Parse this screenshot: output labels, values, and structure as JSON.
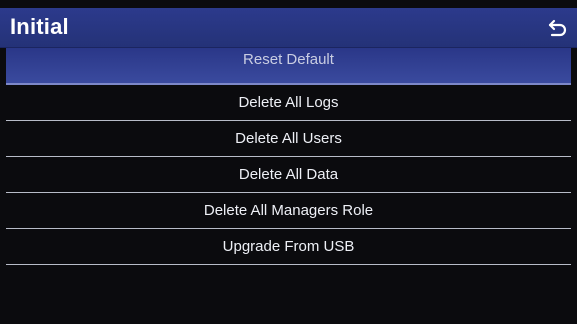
{
  "header": {
    "title": "Initial",
    "back_icon": "back-arrow-icon"
  },
  "menu": {
    "items": [
      {
        "label": "Reset Default",
        "selected": true
      },
      {
        "label": "Delete All Logs"
      },
      {
        "label": "Delete All Users"
      },
      {
        "label": "Delete All Data"
      },
      {
        "label": "Delete All Managers Role"
      },
      {
        "label": "Upgrade From USB"
      }
    ]
  },
  "colors": {
    "header_bg": "#2c3a8c",
    "background": "#0b0b0e",
    "divider": "#b8bcc8",
    "text": "#eef0f6"
  }
}
